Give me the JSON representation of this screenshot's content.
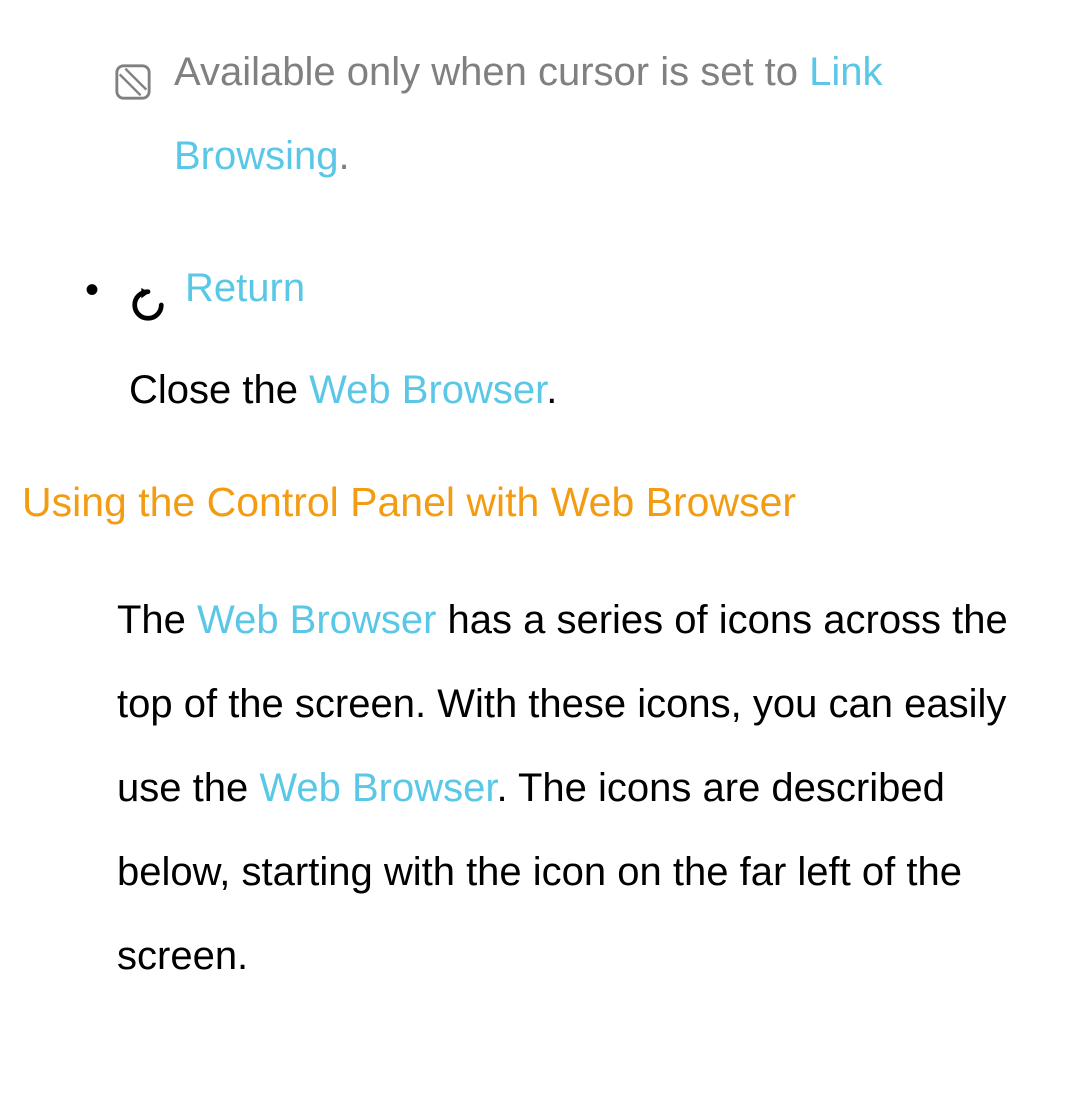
{
  "note": {
    "text_before": "Available only when cursor is set to ",
    "link": "Link Browsing",
    "text_after": "."
  },
  "bullet": {
    "label": "Return",
    "body_before": "Close the ",
    "body_link": "Web Browser",
    "body_after": "."
  },
  "section": {
    "heading": "Using the Control Panel with Web Browser",
    "para_1": "The ",
    "para_link_1": "Web Browser",
    "para_2": " has a series of icons across the top of the screen. With these icons, you can easily use the ",
    "para_link_2": "Web Browser",
    "para_3": ". The icons are described below, starting with the icon on the far left of the screen."
  }
}
